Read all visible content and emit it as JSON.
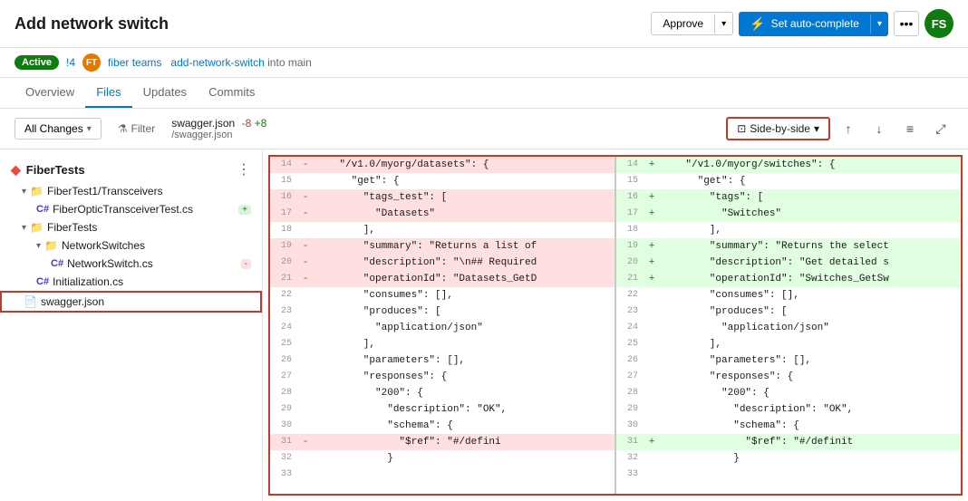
{
  "header": {
    "title": "Add network switch",
    "approve_label": "Approve",
    "autocomplete_label": "Set auto-complete",
    "avatar_initials": "FS"
  },
  "badge_row": {
    "status": "Active",
    "pr_number": "!4",
    "author": "fiber teams",
    "branch_from": "add-network-switch",
    "branch_to": "main",
    "avatar_initials": "FT"
  },
  "tabs": [
    {
      "label": "Overview",
      "active": false
    },
    {
      "label": "Files",
      "active": true
    },
    {
      "label": "Updates",
      "active": false
    },
    {
      "label": "Commits",
      "active": false
    }
  ],
  "toolbar": {
    "all_changes_label": "All Changes",
    "filter_label": "Filter",
    "file_name": "swagger.json",
    "diff_minus": "-8",
    "diff_plus": "+8",
    "file_path": "/swagger.json",
    "view_mode_label": "Side-by-side",
    "up_arrow": "↑",
    "down_arrow": "↓",
    "settings_icon": "⚙",
    "expand_icon": "⤢"
  },
  "sidebar": {
    "title": "FiberTests",
    "items": [
      {
        "label": "FiberTest1/Transceivers",
        "type": "folder",
        "depth": 1,
        "expanded": true
      },
      {
        "label": "FiberOpticTransceiverTest.cs",
        "type": "cs",
        "depth": 2,
        "badge": "+",
        "badge_type": "add"
      },
      {
        "label": "FiberTests",
        "type": "folder",
        "depth": 1,
        "expanded": true
      },
      {
        "label": "NetworkSwitches",
        "type": "folder",
        "depth": 2,
        "expanded": true
      },
      {
        "label": "NetworkSwitch.cs",
        "type": "cs",
        "depth": 3,
        "badge": "-",
        "badge_type": "minus"
      },
      {
        "label": "Initialization.cs",
        "type": "cs",
        "depth": 2
      },
      {
        "label": "swagger.json",
        "type": "json",
        "depth": 1,
        "selected": true
      }
    ]
  },
  "diff": {
    "left_lines": [
      {
        "num": "14",
        "sign": "-",
        "type": "removed",
        "content": "    \"/v1.0/myorg/datasets\": {"
      },
      {
        "num": "15",
        "sign": "",
        "type": "context",
        "content": "      \"get\": {"
      },
      {
        "num": "16",
        "sign": "-",
        "type": "removed",
        "content": "        \"tags_test\": ["
      },
      {
        "num": "17",
        "sign": "-",
        "type": "removed",
        "content": "          \"Datasets\""
      },
      {
        "num": "18",
        "sign": "",
        "type": "context",
        "content": "        ],"
      },
      {
        "num": "19",
        "sign": "-",
        "type": "removed",
        "content": "        \"summary\": \"Returns a list of"
      },
      {
        "num": "20",
        "sign": "-",
        "type": "removed",
        "content": "        \"description\": \"\\n## Required"
      },
      {
        "num": "21",
        "sign": "-",
        "type": "removed",
        "content": "        \"operationId\": \"Datasets_GetD"
      },
      {
        "num": "22",
        "sign": "",
        "type": "context",
        "content": "        \"consumes\": [],"
      },
      {
        "num": "23",
        "sign": "",
        "type": "context",
        "content": "        \"produces\": ["
      },
      {
        "num": "24",
        "sign": "",
        "type": "context",
        "content": "          \"application/json\""
      },
      {
        "num": "25",
        "sign": "",
        "type": "context",
        "content": "        ],"
      },
      {
        "num": "26",
        "sign": "",
        "type": "context",
        "content": "        \"parameters\": [],"
      },
      {
        "num": "27",
        "sign": "",
        "type": "context",
        "content": "        \"responses\": {"
      },
      {
        "num": "28",
        "sign": "",
        "type": "context",
        "content": "          \"200\": {"
      },
      {
        "num": "29",
        "sign": "",
        "type": "context",
        "content": "            \"description\": \"OK\","
      },
      {
        "num": "30",
        "sign": "",
        "type": "context",
        "content": "            \"schema\": {"
      },
      {
        "num": "31",
        "sign": "-",
        "type": "removed",
        "content": "              \"$ref\": \"#/defini"
      },
      {
        "num": "32",
        "sign": "",
        "type": "context",
        "content": "            }"
      },
      {
        "num": "33",
        "sign": "",
        "type": "context",
        "content": ""
      }
    ],
    "right_lines": [
      {
        "num": "14",
        "sign": "+",
        "type": "added",
        "content": "    \"/v1.0/myorg/switches\": {"
      },
      {
        "num": "15",
        "sign": "",
        "type": "context",
        "content": "      \"get\": {"
      },
      {
        "num": "16",
        "sign": "+",
        "type": "added",
        "content": "        \"tags\": ["
      },
      {
        "num": "17",
        "sign": "+",
        "type": "added",
        "content": "          \"Switches\""
      },
      {
        "num": "18",
        "sign": "",
        "type": "context",
        "content": "        ],"
      },
      {
        "num": "19",
        "sign": "+",
        "type": "added",
        "content": "        \"summary\": \"Returns the select"
      },
      {
        "num": "20",
        "sign": "+",
        "type": "added",
        "content": "        \"description\": \"Get detailed s"
      },
      {
        "num": "21",
        "sign": "+",
        "type": "added",
        "content": "        \"operationId\": \"Switches_GetSw"
      },
      {
        "num": "22",
        "sign": "",
        "type": "context",
        "content": "        \"consumes\": [],"
      },
      {
        "num": "23",
        "sign": "",
        "type": "context",
        "content": "        \"produces\": ["
      },
      {
        "num": "24",
        "sign": "",
        "type": "context",
        "content": "          \"application/json\""
      },
      {
        "num": "25",
        "sign": "",
        "type": "context",
        "content": "        ],"
      },
      {
        "num": "26",
        "sign": "",
        "type": "context",
        "content": "        \"parameters\": [],"
      },
      {
        "num": "27",
        "sign": "",
        "type": "context",
        "content": "        \"responses\": {"
      },
      {
        "num": "28",
        "sign": "",
        "type": "context",
        "content": "          \"200\": {"
      },
      {
        "num": "29",
        "sign": "",
        "type": "context",
        "content": "            \"description\": \"OK\","
      },
      {
        "num": "30",
        "sign": "",
        "type": "context",
        "content": "            \"schema\": {"
      },
      {
        "num": "31",
        "sign": "+",
        "type": "added",
        "content": "              \"$ref\": \"#/definit"
      },
      {
        "num": "32",
        "sign": "",
        "type": "context",
        "content": "            }"
      },
      {
        "num": "33",
        "sign": "",
        "type": "context",
        "content": ""
      }
    ]
  }
}
